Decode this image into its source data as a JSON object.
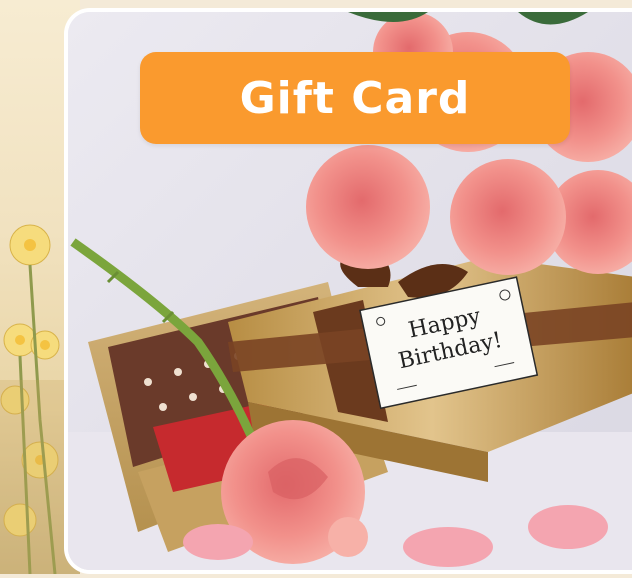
{
  "badge": {
    "label": "Gift Card"
  },
  "tag": {
    "line1": "Happy",
    "line2": "Birthday!"
  },
  "colors": {
    "badge": "#fa9a2e",
    "rose": "#f08a86",
    "box_gold": "#c9a35c",
    "ribbon": "#6b3a1e",
    "background": "#e8e6ee"
  },
  "icons": [
    "rose-image",
    "gift-box-image",
    "birthday-tag-image",
    "flower-decoration"
  ]
}
